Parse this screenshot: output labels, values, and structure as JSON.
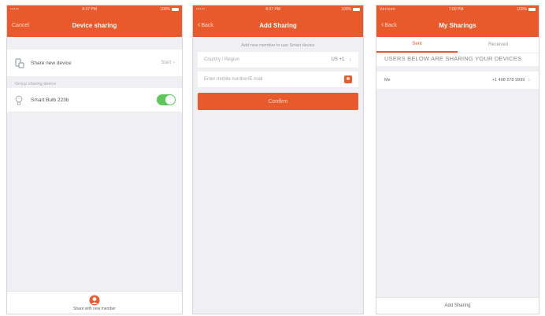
{
  "status": {
    "screen1": {
      "carrier": "•••••",
      "time": "8:27 PM",
      "battery": "100%"
    },
    "screen2": {
      "carrier": "•••••",
      "time": "8:27 PM",
      "battery": "100%"
    },
    "screen3": {
      "carrier": "Verizon",
      "time": "7:00 PM",
      "battery": "100%"
    }
  },
  "device_sharing": {
    "cancel": "Cancel",
    "title": "Device sharing",
    "share_row": {
      "label": "Share new device",
      "action": "Start"
    },
    "section_label": "Group sharing device",
    "device": {
      "name": "Smart Bulb 223b",
      "enabled": true
    },
    "bottom_label": "Share with new member"
  },
  "add_sharing": {
    "back": "Back",
    "title": "Add Sharing",
    "hint": "Add new member to use Smart device",
    "country_label": "Country / Region",
    "country_value": "US +1",
    "phone_placeholder": "Enter mobile number/E-mail",
    "confirm": "Confirm"
  },
  "my_sharings": {
    "back": "Back",
    "title": "My Sharings",
    "tabs": [
      "Sent",
      "Received"
    ],
    "heading": "USERS BELOW ARE SHARING YOUR DEVICES",
    "user": {
      "name": "Me",
      "phone": "+1 408 278 9999"
    },
    "add_button": "Add Sharing"
  },
  "colors": {
    "accent": "#e85a2b",
    "toggle_on": "#5cc85a",
    "background": "#efeff4"
  }
}
